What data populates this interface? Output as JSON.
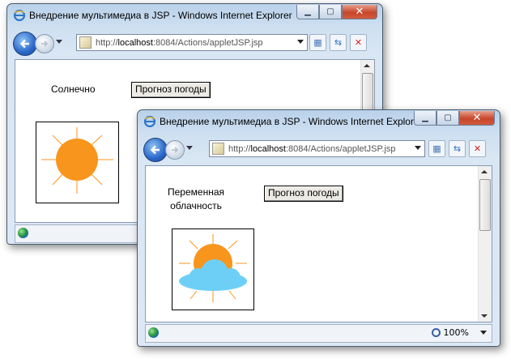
{
  "window_back": {
    "title": "Внедрение мультимедиа в JSP - Windows Internet Explorer",
    "url_prefix": "http://",
    "url_host": "localhost",
    "url_rest": ":8084/Actions/appletJSP.jsp",
    "weather_label": "Солнечно",
    "forecast_button": "Прогноз погоды",
    "weather_icon": "sun-icon"
  },
  "window_front": {
    "title": "Внедрение мультимедиа в JSP - Windows Internet Explorer",
    "url_prefix": "http://",
    "url_host": "localhost",
    "url_rest": ":8084/Actions/appletJSP.jsp",
    "weather_label_line1": "Переменная",
    "weather_label_line2": "облачность",
    "forecast_button": "Прогноз погоды",
    "weather_icon": "sun-behind-cloud-icon",
    "zoom_level": "100%"
  },
  "colors": {
    "sun": "#f8951d",
    "cloud": "#6ecff6",
    "ray": "#f8951d"
  }
}
